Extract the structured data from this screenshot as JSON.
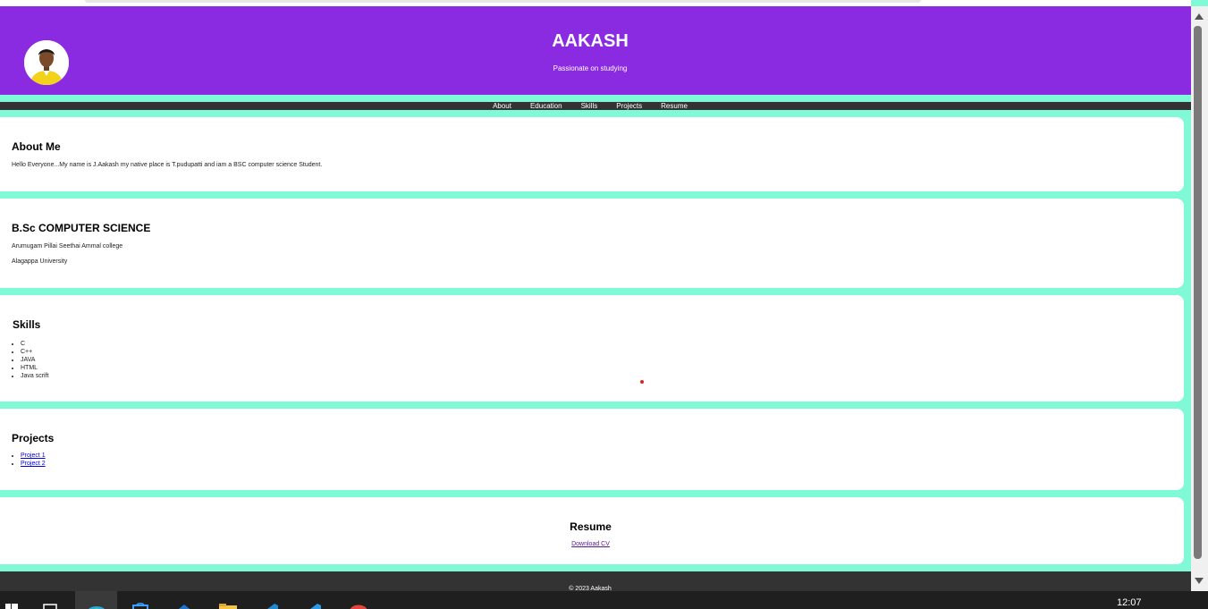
{
  "header": {
    "title": "AAKASH",
    "tagline": "Passionate on studying"
  },
  "nav": {
    "items": [
      "About",
      "Education",
      "Skills",
      "Projects",
      "Resume"
    ]
  },
  "about": {
    "heading": "About Me",
    "text": "Hello Everyone...My name is J.Aakash my native place is T.pudupatti and iam a BSC computer science Student."
  },
  "education": {
    "heading": "B.Sc COMPUTER SCIENCE",
    "college": "Arumugam Pillai Seethai Ammal college",
    "university": "Alagappa University"
  },
  "skills": {
    "heading": "Skills",
    "items": [
      "C",
      "C++",
      "JAVA",
      "HTML",
      "Java scrift"
    ]
  },
  "projects": {
    "heading": "Projects",
    "items": [
      "Project 1",
      "Project 2"
    ]
  },
  "resume": {
    "heading": "Resume",
    "link": "Download CV"
  },
  "footer": {
    "text": "© 2023 Aakash"
  },
  "taskbar": {
    "clock": "12:07",
    "icons": [
      "start-icon",
      "task-view-icon",
      "edge-browser-icon",
      "store-icon",
      "mail-icon",
      "file-explorer-icon",
      "vscode-icon",
      "vscode-icon-2",
      "chrome-icon"
    ]
  },
  "colors": {
    "header_bg": "#8a2be2",
    "page_bg": "#7ff9d6",
    "nav_bg": "#333333",
    "card_bg": "#ffffff"
  }
}
